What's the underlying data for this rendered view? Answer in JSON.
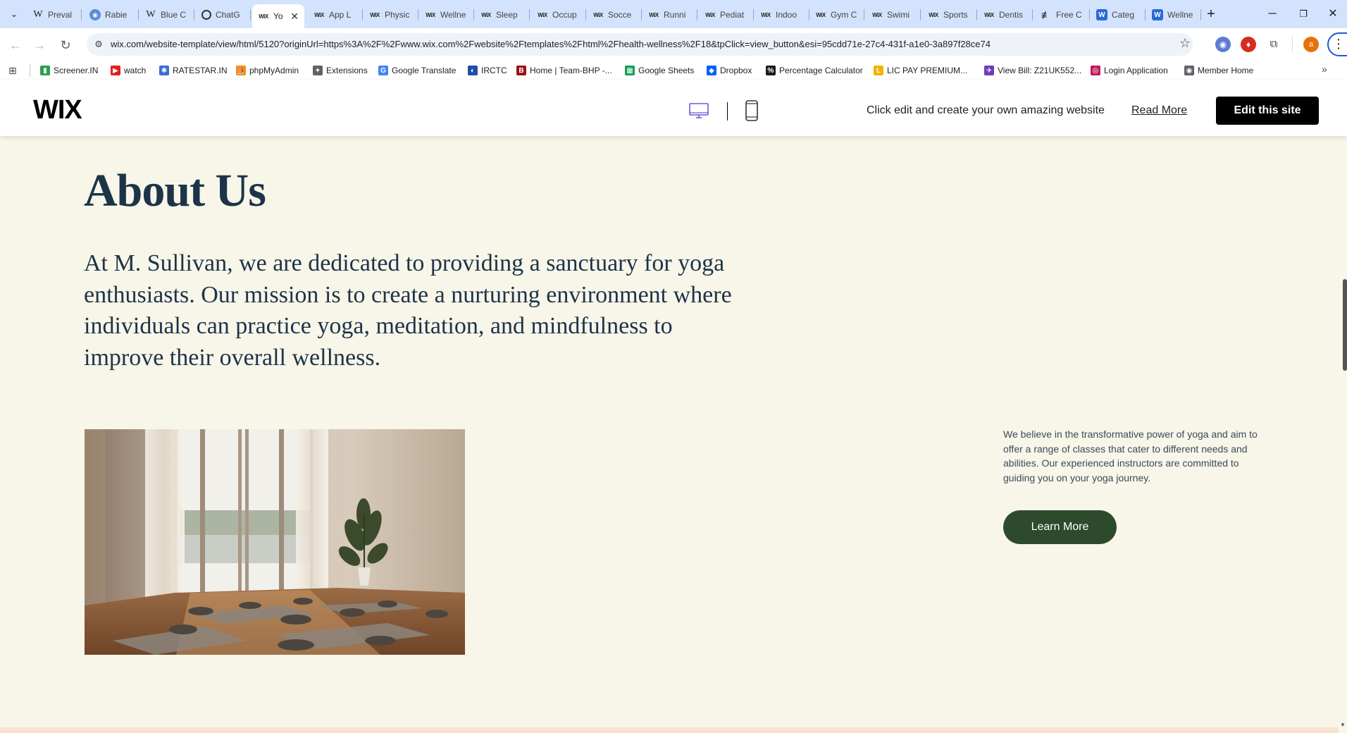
{
  "browser": {
    "tabs": [
      {
        "label": "Preval",
        "icon": "wikipedia-icon"
      },
      {
        "label": "Rabie",
        "icon": "globe-icon"
      },
      {
        "label": "Blue C",
        "icon": "wikipedia-icon"
      },
      {
        "label": "ChatG",
        "icon": "chatgpt-icon"
      },
      {
        "label": "Yo",
        "icon": "wix-icon",
        "active": true
      },
      {
        "label": "App L",
        "icon": "wix-icon"
      },
      {
        "label": "Physic",
        "icon": "wix-icon"
      },
      {
        "label": "Wellne",
        "icon": "wix-icon"
      },
      {
        "label": "Sleep",
        "icon": "wix-icon"
      },
      {
        "label": "Occup",
        "icon": "wix-icon"
      },
      {
        "label": "Socce",
        "icon": "wix-icon"
      },
      {
        "label": "Runni",
        "icon": "wix-icon"
      },
      {
        "label": "Pediat",
        "icon": "wix-icon"
      },
      {
        "label": "Indoo",
        "icon": "wix-icon"
      },
      {
        "label": "Gym C",
        "icon": "wix-icon"
      },
      {
        "label": "Swimi",
        "icon": "wix-icon"
      },
      {
        "label": "Sports",
        "icon": "wix-icon"
      },
      {
        "label": "Dentis",
        "icon": "wix-icon"
      },
      {
        "label": "Free C",
        "icon": "framer-icon"
      },
      {
        "label": "Categ",
        "icon": "wordpress-icon"
      },
      {
        "label": "Wellne",
        "icon": "wordpress-icon"
      }
    ],
    "url": "wix.com/website-template/view/html/5120?originUrl=https%3A%2F%2Fwww.wix.com%2Fwebsite%2Ftemplates%2Fhtml%2Fhealth-wellness%2F18&tpClick=view_button&esi=95cdd71e-27c4-431f-a1e0-3a897f28ce74",
    "profile_initial": "a",
    "bookmarks": [
      {
        "label": "Screener.IN",
        "icon": "bar-chart-icon",
        "color": "#2e9e4e"
      },
      {
        "label": "watch",
        "icon": "youtube-icon",
        "color": "#e02020"
      },
      {
        "label": "RATESTAR.IN",
        "icon": "ratestar-icon",
        "color": "#3b6ed6"
      },
      {
        "label": "phpMyAdmin",
        "icon": "phpmyadmin-icon",
        "color": "#f29111"
      },
      {
        "label": "Extensions",
        "icon": "puzzle-icon",
        "color": "#5f6368"
      },
      {
        "label": "Google Translate",
        "icon": "translate-icon",
        "color": "#4285f4"
      },
      {
        "label": "IRCTC",
        "icon": "irctc-icon",
        "color": "#1d4ea8"
      },
      {
        "label": "Home | Team-BHP -...",
        "icon": "teambhp-icon",
        "color": "#9a1414"
      },
      {
        "label": "Google Sheets",
        "icon": "sheets-icon",
        "color": "#0f9d58"
      },
      {
        "label": "Dropbox",
        "icon": "dropbox-icon",
        "color": "#0061fe"
      },
      {
        "label": "Percentage Calculator",
        "icon": "percent-icon",
        "color": "#1b1b1b"
      },
      {
        "label": "LIC PAY PREMIUM...",
        "icon": "lic-icon",
        "color": "#f0b400"
      },
      {
        "label": "View Bill: Z21UK552...",
        "icon": "bill-icon",
        "color": "#6a3db8"
      },
      {
        "label": "Login Application",
        "icon": "login-icon",
        "color": "#c2185b"
      },
      {
        "label": "Member Home",
        "icon": "globe-icon",
        "color": "#5f6368"
      }
    ]
  },
  "wix_bar": {
    "logo": "WIX",
    "tagline": "Click edit and create your own amazing website",
    "read_more": "Read More",
    "edit_button": "Edit this site",
    "accent": "#6b5dd3"
  },
  "about": {
    "title": "About Us",
    "lead": "At M. Sullivan, we are dedicated to providing a sanctuary for yoga enthusiasts. Our mission is to create a nurturing environment where individuals can practice yoga, meditation, and mindfulness to improve their overall wellness.",
    "body": "We believe in the transformative power of yoga and aim to offer a range of classes that cater to different needs and abilities. Our experienced instructors are committed to guiding you on your yoga journey.",
    "button": "Learn More",
    "button_color": "#2e4a2c",
    "heading_color": "#1d3349",
    "background": "#f7f6e8"
  }
}
